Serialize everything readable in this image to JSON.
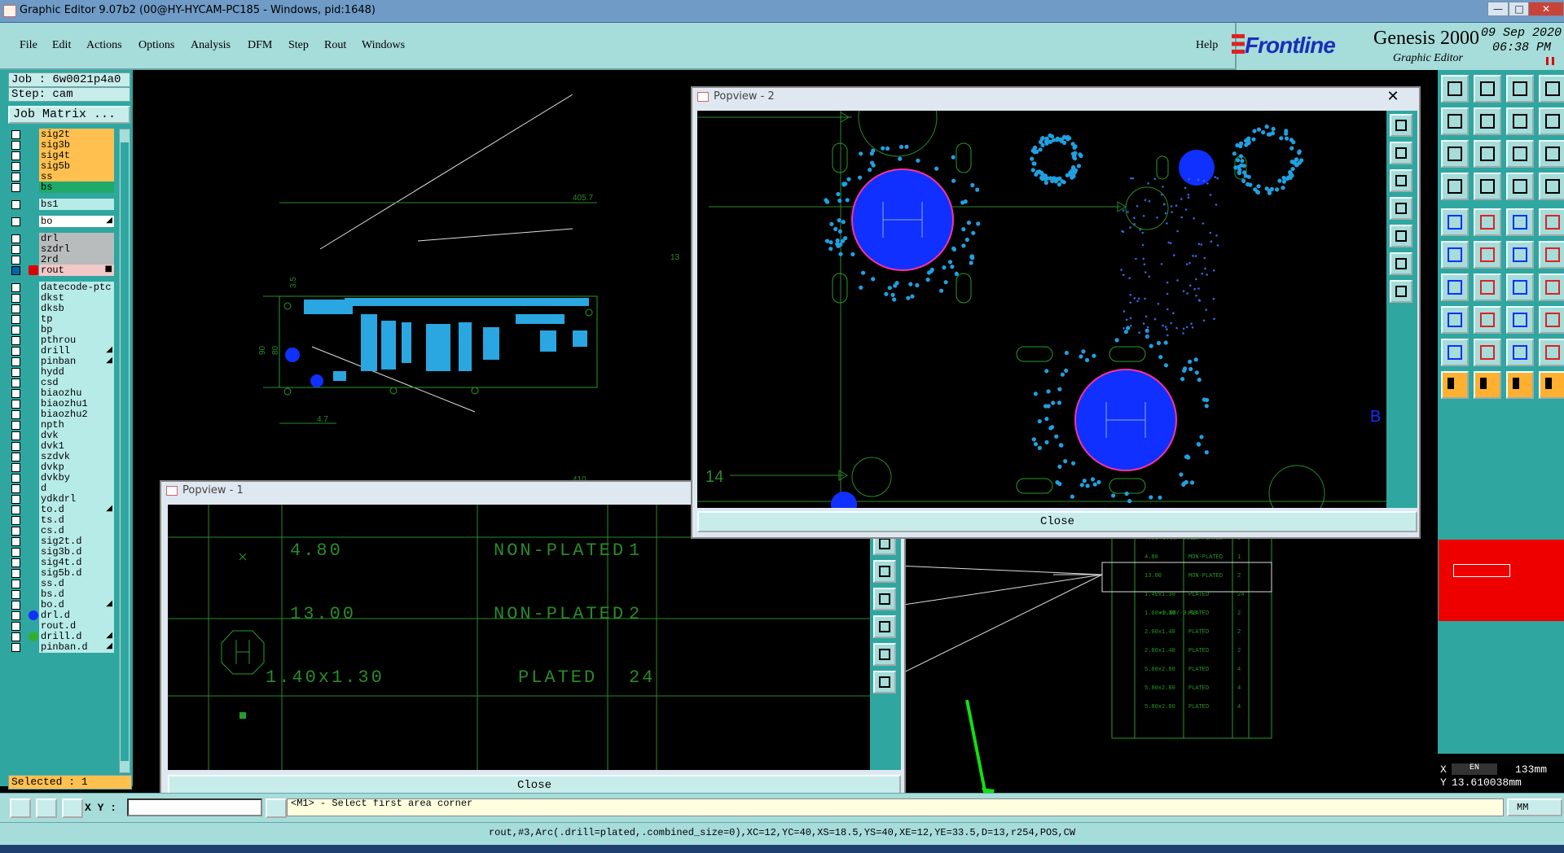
{
  "window": {
    "title": "Graphic Editor 9.07b2 (00@HY-HYCAM-PC185 - Windows, pid:1648)",
    "min": "—",
    "max": "□",
    "close": "✕"
  },
  "menu": [
    "File",
    "Edit",
    "Actions",
    "Options",
    "Analysis",
    "DFM",
    "Step",
    "Rout",
    "Windows"
  ],
  "help": "Help",
  "logo": {
    "brand": "Frontline",
    "product": "Genesis 2000",
    "subtitle": "Graphic Editor",
    "date": "09 Sep 2020",
    "time": "06:38 PM"
  },
  "job": {
    "job": "Job : 6w0021p4a0",
    "step": "Step: cam",
    "matrix": "Job Matrix ..."
  },
  "layers": [
    {
      "name": "sig2t",
      "style": "orange"
    },
    {
      "name": "sig3b",
      "style": "orange"
    },
    {
      "name": "sig4t",
      "style": "orange"
    },
    {
      "name": "sig5b",
      "style": "orange"
    },
    {
      "name": "ss",
      "style": "orange"
    },
    {
      "name": "bs",
      "style": "green"
    },
    {
      "name": "bs1",
      "style": "plain",
      "gap": true
    },
    {
      "name": "bo",
      "style": "white",
      "gap": true,
      "mark": "◢"
    },
    {
      "name": "drl",
      "style": "gray",
      "gap": true
    },
    {
      "name": "szdrl",
      "style": "gray"
    },
    {
      "name": "2rd",
      "style": "gray"
    },
    {
      "name": "rout",
      "style": "pink",
      "active": true,
      "mark": "■"
    },
    {
      "name": "datecode-ptc",
      "style": "plain",
      "gap": true
    },
    {
      "name": "dkst",
      "style": "plain"
    },
    {
      "name": "dksb",
      "style": "plain"
    },
    {
      "name": "tp",
      "style": "plain"
    },
    {
      "name": "bp",
      "style": "plain"
    },
    {
      "name": "pthrou",
      "style": "plain"
    },
    {
      "name": "drill",
      "style": "plain",
      "mark": "◢"
    },
    {
      "name": "pinban",
      "style": "plain",
      "mark": "◢"
    },
    {
      "name": "hydd",
      "style": "plain"
    },
    {
      "name": "csd",
      "style": "plain"
    },
    {
      "name": "biaozhu",
      "style": "plain"
    },
    {
      "name": "biaozhu1",
      "style": "plain"
    },
    {
      "name": "biaozhu2",
      "style": "plain"
    },
    {
      "name": "npth",
      "style": "plain"
    },
    {
      "name": "dvk",
      "style": "plain"
    },
    {
      "name": "dvk1",
      "style": "plain"
    },
    {
      "name": "szdvk",
      "style": "plain"
    },
    {
      "name": "dvkp",
      "style": "plain"
    },
    {
      "name": "dvkby",
      "style": "plain"
    },
    {
      "name": "d",
      "style": "plain"
    },
    {
      "name": "ydkdrl",
      "style": "plain"
    },
    {
      "name": "to.d",
      "style": "plain",
      "mark": "◢"
    },
    {
      "name": "ts.d",
      "style": "plain"
    },
    {
      "name": "cs.d",
      "style": "plain"
    },
    {
      "name": "sig2t.d",
      "style": "plain"
    },
    {
      "name": "sig3b.d",
      "style": "plain"
    },
    {
      "name": "sig4t.d",
      "style": "plain"
    },
    {
      "name": "sig5b.d",
      "style": "plain"
    },
    {
      "name": "ss.d",
      "style": "plain"
    },
    {
      "name": "bs.d",
      "style": "plain"
    },
    {
      "name": "bo.d",
      "style": "plain",
      "mark": "◢"
    },
    {
      "name": "drl.d",
      "style": "plain",
      "dot": "#1030ff"
    },
    {
      "name": "rout.d",
      "style": "plain"
    },
    {
      "name": "drill.d",
      "style": "plain",
      "dot": "#30b030",
      "mark": "◢"
    },
    {
      "name": "pinban.d",
      "style": "plain",
      "mark": "◢"
    }
  ],
  "selected": "Selected : 1",
  "popview1": {
    "title": "Popview - 1",
    "close": "Close",
    "rows": [
      {
        "size": "4.80",
        "type": "NON-PLATED",
        "count": "1"
      },
      {
        "size": "13.00",
        "type": "NON-PLATED",
        "count": "2"
      },
      {
        "size": "1.40x1.30",
        "type": "PLATED",
        "count": "24"
      }
    ]
  },
  "popview2": {
    "title": "Popview - 2",
    "close": "Close",
    "x": "✕",
    "label14": "14",
    "labelB": "B"
  },
  "canvas": {
    "dim1": "405.7",
    "dim2": "3.5",
    "dim3": "13",
    "dim4": "90",
    "dim5": "80",
    "dim6": "4.7",
    "dim7": "410",
    "table": [
      {
        "size": "4.00",
        "type": "MON-PLATED",
        "count": "3",
        "tol": "+0.05/-0.05"
      },
      {
        "size": "4.80",
        "type": "MON-PLATED",
        "count": "1"
      },
      {
        "size": "13.00",
        "type": "MON-PLATED",
        "count": "2"
      },
      {
        "size": "1.40x1.30",
        "type": "PLATED",
        "count": "24"
      },
      {
        "size": "1.60x1.30",
        "type": "PLATED",
        "count": "2",
        "tol": "+0.08/-0.08"
      },
      {
        "size": "2.00x1.40",
        "type": "PLATED",
        "count": "2"
      },
      {
        "size": "2.80x1.40",
        "type": "PLATED",
        "count": "2"
      },
      {
        "size": "5.00x2.80",
        "type": "PLATED",
        "count": "4"
      },
      {
        "size": "5.80x2.80",
        "type": "PLATED",
        "count": "4"
      },
      {
        "size": "5.80x2.80",
        "type": "PLATED",
        "count": "4"
      }
    ]
  },
  "coords": {
    "x": "X",
    "y": "Y",
    "xval": "133mm",
    "yval": "13.610038mm",
    "ime": "EN"
  },
  "cmd": {
    "xy": "X Y :",
    "prompt": "<M1> - Select first area corner",
    "unit": "MM"
  },
  "status": "rout,#3,Arc(.drill=plated,.combined_size=0),XC=12,YC=40,XS=18.5,YS=40,XE=12,YE=33.5,D=13,r254,POS,CW"
}
